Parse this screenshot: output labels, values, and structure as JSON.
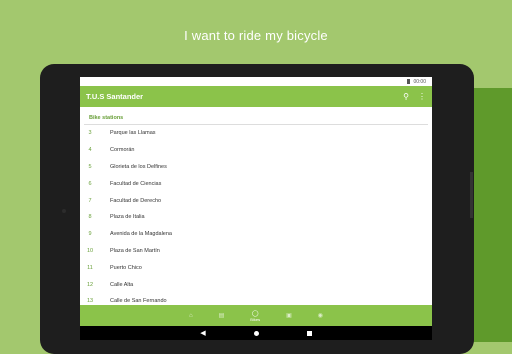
{
  "headline": "I want to ride my bicycle",
  "status": {
    "time": "00:00"
  },
  "appbar": {
    "title": "T.U.S Santander",
    "search_icon": "search-icon",
    "menu_icon": "more-vert-icon"
  },
  "section_title": "Bike stations",
  "stations": [
    {
      "num": "3",
      "name": "Parque las Llamas"
    },
    {
      "num": "4",
      "name": "Cormorán"
    },
    {
      "num": "5",
      "name": "Glorieta de los Delfines"
    },
    {
      "num": "6",
      "name": "Facultad de Ciencias"
    },
    {
      "num": "7",
      "name": "Facultad de Derecho"
    },
    {
      "num": "8",
      "name": "Plaza de Italia"
    },
    {
      "num": "9",
      "name": "Avenida de la Magdalena"
    },
    {
      "num": "10",
      "name": "Plaza de San Martín"
    },
    {
      "num": "11",
      "name": "Puerto Chico"
    },
    {
      "num": "12",
      "name": "Calle Alta"
    },
    {
      "num": "13",
      "name": "Calle de San Fernando"
    }
  ],
  "bottom_nav": {
    "active_label": "Bikes"
  },
  "colors": {
    "accent": "#8bc34a",
    "dark_accent": "#689f38",
    "background": "#a3c86e"
  }
}
